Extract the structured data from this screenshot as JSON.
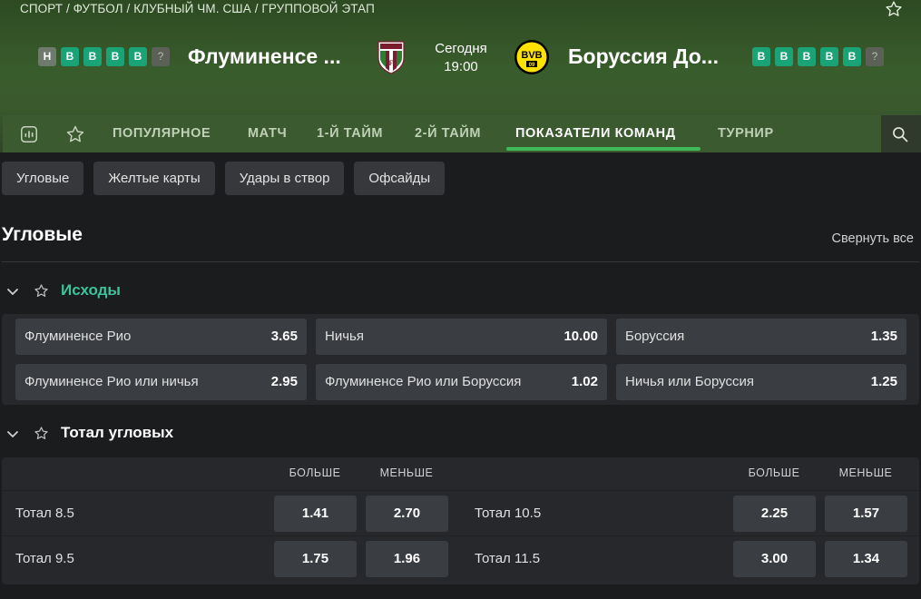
{
  "breadcrumb": "СПОРТ / ФУТБОЛ / КЛУБНЫЙ ЧМ. США / ГРУППОВОЙ ЭТАП",
  "home": {
    "name": "Флуминенсе ...",
    "form": [
      "Н",
      "В",
      "В",
      "В",
      "В",
      "?"
    ]
  },
  "away": {
    "name": "Боруссия До...",
    "form": [
      "В",
      "В",
      "В",
      "В",
      "В",
      "?"
    ]
  },
  "match_time": {
    "day": "Сегодня",
    "time": "19:00"
  },
  "tabs": [
    {
      "label": "ПОПУЛЯРНОЕ"
    },
    {
      "label": "МАТЧ"
    },
    {
      "label": "1-Й ТАЙМ"
    },
    {
      "label": "2-Й ТАЙМ"
    },
    {
      "label": "ПОКАЗАТЕЛИ КОМАНД",
      "active": true
    },
    {
      "label": "ТУРНИР"
    }
  ],
  "filters": [
    "Угловые",
    "Желтые карты",
    "Удары в створ",
    "Офсайды"
  ],
  "section": {
    "title": "Угловые",
    "collapse_label": "Свернуть все"
  },
  "outcomes": {
    "title": "Исходы",
    "rows": [
      [
        {
          "label": "Флуминенсе Рио",
          "odd": "3.65"
        },
        {
          "label": "Ничья",
          "odd": "10.00"
        },
        {
          "label": "Боруссия",
          "odd": "1.35"
        }
      ],
      [
        {
          "label": "Флуминенсе Рио или ничья",
          "odd": "2.95"
        },
        {
          "label": "Флуминенсе Рио или Боруссия",
          "odd": "1.02"
        },
        {
          "label": "Ничья или Боруссия",
          "odd": "1.25"
        }
      ]
    ]
  },
  "totals": {
    "title": "Тотал угловых",
    "over_label": "БОЛЬШЕ",
    "under_label": "МЕНЬШЕ",
    "left": [
      {
        "label": "Тотал 8.5",
        "over": "1.41",
        "under": "2.70"
      },
      {
        "label": "Тотал 9.5",
        "over": "1.75",
        "under": "1.96"
      }
    ],
    "right": [
      {
        "label": "Тотал 10.5",
        "over": "2.25",
        "under": "1.57"
      },
      {
        "label": "Тотал 11.5",
        "over": "3.00",
        "under": "1.34"
      }
    ]
  },
  "colors": {
    "accent_green": "#41b85a",
    "outcome_title": "#3ec39a",
    "win_chip": "#1aa376"
  }
}
